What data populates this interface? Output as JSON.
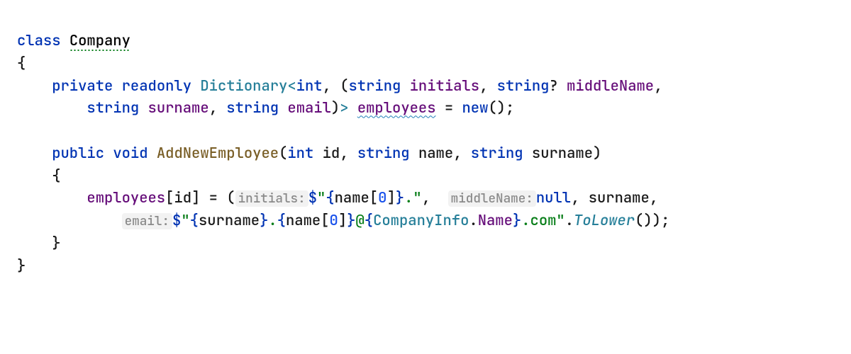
{
  "code": {
    "kw_class": "class",
    "cls_name": "Company",
    "brace_open": "{",
    "brace_close": "}",
    "kw_private": "private",
    "kw_readonly": "readonly",
    "type_dict": "Dictionary",
    "lt": "<",
    "gt": ">",
    "tprim_int": "int",
    "comma": ",",
    "paren_open": "(",
    "paren_close": ")",
    "tprim_string": "string",
    "tup_initials": "initials",
    "q": "?",
    "tup_middleName": "middleName",
    "tup_surname": "surname",
    "tup_email": "email",
    "field_employees": "employees",
    "eq": "=",
    "kw_new": "new",
    "parens_empty": "()",
    "semi": ";",
    "kw_public": "public",
    "kw_void": "void",
    "meth_name": "AddNewEmployee",
    "param_id": "id",
    "param_name": "name",
    "param_surname": "surname",
    "lbracket": "[",
    "rbracket": "]",
    "hint_initials": "initials:",
    "dollar": "$",
    "quote": "\"",
    "interp_open": "{",
    "interp_close": "}",
    "zero": "0",
    "str_dot": ".",
    "hint_middleName": "middleName:",
    "kw_null": "null",
    "hint_email": "email:",
    "str_at": "@",
    "companyinfo": "CompanyInfo",
    "dot": ".",
    "prop_Name": "Name",
    "str_dotcom": ".com",
    "mcall_tolower": "ToLower"
  },
  "colors": {
    "keyword": "#0033b3",
    "type": "#267f99",
    "field": "#660e7a",
    "method": "#795e26",
    "string": "#067d17",
    "number": "#1750eb",
    "hint_bg": "#f2f2f2",
    "hint_fg": "#8a8a8a",
    "wavy": "#1e7db8"
  }
}
